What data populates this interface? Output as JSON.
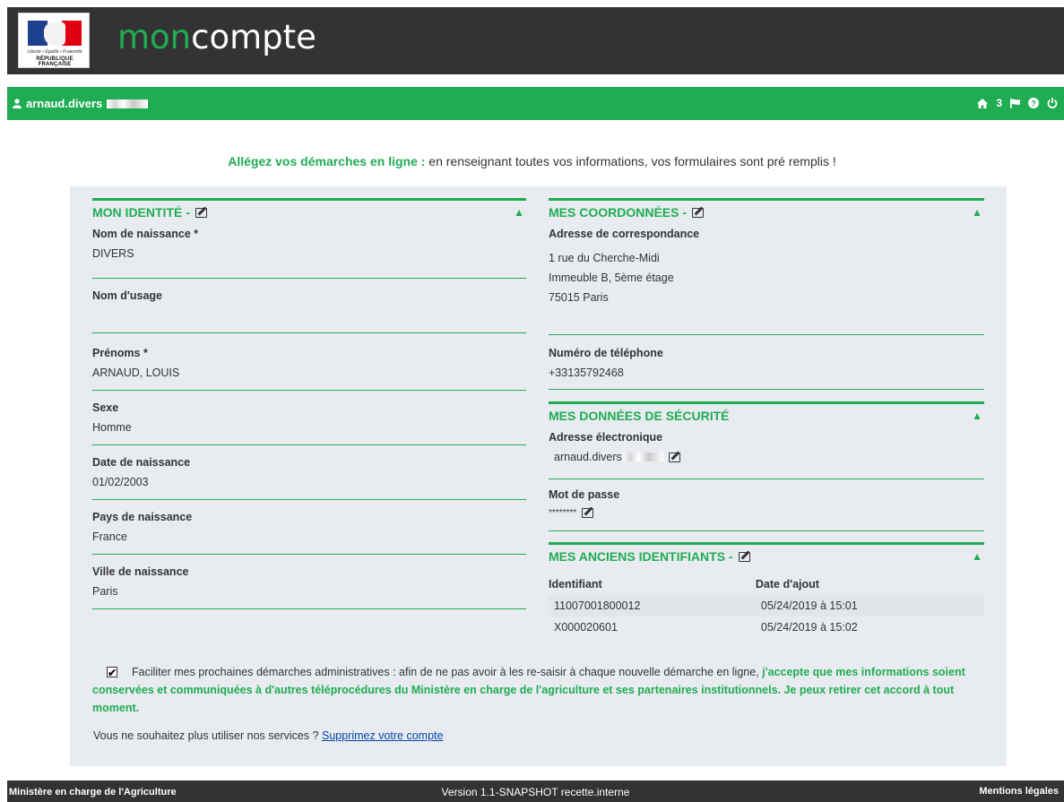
{
  "header": {
    "logo_motto": "Liberté • Égalité • Fraternité",
    "logo_rf": "RÉPUBLIQUE FRANÇAISE",
    "brand_mon": "mon",
    "brand_compte": "compte"
  },
  "userbar": {
    "username": "arnaud.divers",
    "message_count": "3"
  },
  "intro": {
    "highlight": "Allégez vos démarches en ligne :",
    "text": " en renseignant toutes vos informations, vos formulaires sont pré remplis !"
  },
  "identity": {
    "title": "MON IDENTITÉ -",
    "fields": [
      {
        "label": "Nom de naissance *",
        "value": "DIVERS"
      },
      {
        "label": "Nom d'usage",
        "value": ""
      },
      {
        "label": "Prénoms *",
        "value": "ARNAUD, LOUIS"
      },
      {
        "label": "Sexe",
        "value": "Homme"
      },
      {
        "label": "Date de naissance",
        "value": "01/02/2003"
      },
      {
        "label": "Pays de naissance",
        "value": "France"
      },
      {
        "label": "Ville de naissance",
        "value": "Paris"
      }
    ]
  },
  "coordonnees": {
    "title": "MES COORDONNÉES -",
    "address_label": "Adresse de correspondance",
    "address_lines": [
      "1 rue du Cherche-Midi",
      "Immeuble B, 5ème étage",
      "75015 Paris"
    ],
    "phone_label": "Numéro de téléphone",
    "phone_value": "+33135792468"
  },
  "securite": {
    "title": "MES DONNÉES DE SÉCURITÉ",
    "email_label": "Adresse électronique",
    "email_value": "arnaud.divers",
    "password_label": "Mot de passe",
    "password_value": "********"
  },
  "anciens": {
    "title": "MES ANCIENS IDENTIFIANTS -",
    "headers": [
      "Identifiant",
      "Date d'ajout"
    ],
    "rows": [
      [
        "11007001800012",
        "05/24/2019 à 15:01"
      ],
      [
        "X000020601",
        "05/24/2019 à 15:02"
      ]
    ]
  },
  "consent": {
    "text": "Faciliter mes prochaines démarches administratives : afin de ne pas avoir à les re-saisir à chaque nouvelle démarche en ligne, ",
    "highlight": "j'accepte que mes informations soient conservées et communiquées à d'autres téléprocédures du Ministère en charge de l'agriculture et ses partenaires institutionnels. Je peux retirer cet accord à tout moment.",
    "checked": true
  },
  "delete": {
    "text": "Vous ne souhaitez plus utiliser nos services ? ",
    "link": "Supprimez votre compte"
  },
  "footer": {
    "left": "Ministère en charge de l'Agriculture",
    "center": "Version 1.1-SNAPSHOT recette.interne",
    "right": "Mentions légales"
  },
  "colors": {
    "accent": "#20ac53",
    "dark": "#333333",
    "panel": "#e8ecf0"
  }
}
